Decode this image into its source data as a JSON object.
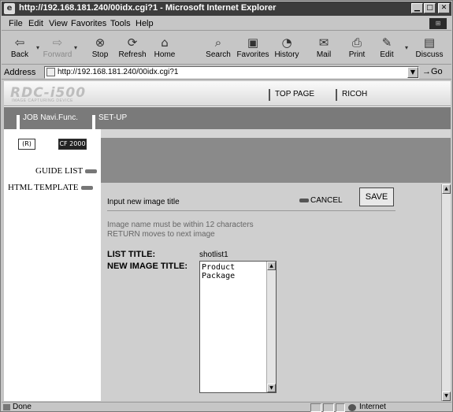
{
  "window": {
    "title": "http://192.168.181.240/00idx.cgi?1 - Microsoft Internet Explorer",
    "controls": {
      "minimize": "▁",
      "maximize": "□",
      "close": "✕"
    }
  },
  "menu": [
    "File",
    "Edit",
    "View",
    "Favorites",
    "Tools",
    "Help"
  ],
  "toolbar": {
    "back": "Back",
    "forward": "Forward",
    "stop": "Stop",
    "refresh": "Refresh",
    "home": "Home",
    "search": "Search",
    "favorites": "Favorites",
    "history": "History",
    "mail": "Mail",
    "print": "Print",
    "edit": "Edit",
    "discuss": "Discuss"
  },
  "address": {
    "label": "Address",
    "value": "http://192.168.181.240/00idx.cgi?1",
    "go": "Go"
  },
  "page": {
    "brand": "RDC-i500",
    "brand_sub": "IMAGE CAPTURING DEVICE",
    "top_links": [
      "TOP PAGE",
      "RICOH"
    ],
    "nav": [
      "JOB Navi.Func.",
      "SET-UP"
    ],
    "side_buttons": [
      "(R)",
      "CF 2000"
    ],
    "sidebar": [
      "GUIDE LIST",
      "HTML TEMPLATE"
    ],
    "form": {
      "title": "Input new image title",
      "cancel": "CANCEL",
      "save": "SAVE",
      "info": [
        "Image name must be within 12 characters",
        "RETURN moves to next image"
      ],
      "list_title_label": "LIST TITLE:",
      "list_title_value": "shotlist1",
      "new_image_title_label": "NEW IMAGE TITLE:",
      "new_image_title_lines": [
        "Product",
        "Package"
      ]
    }
  },
  "status": {
    "text": "Done",
    "zone": "Internet"
  }
}
